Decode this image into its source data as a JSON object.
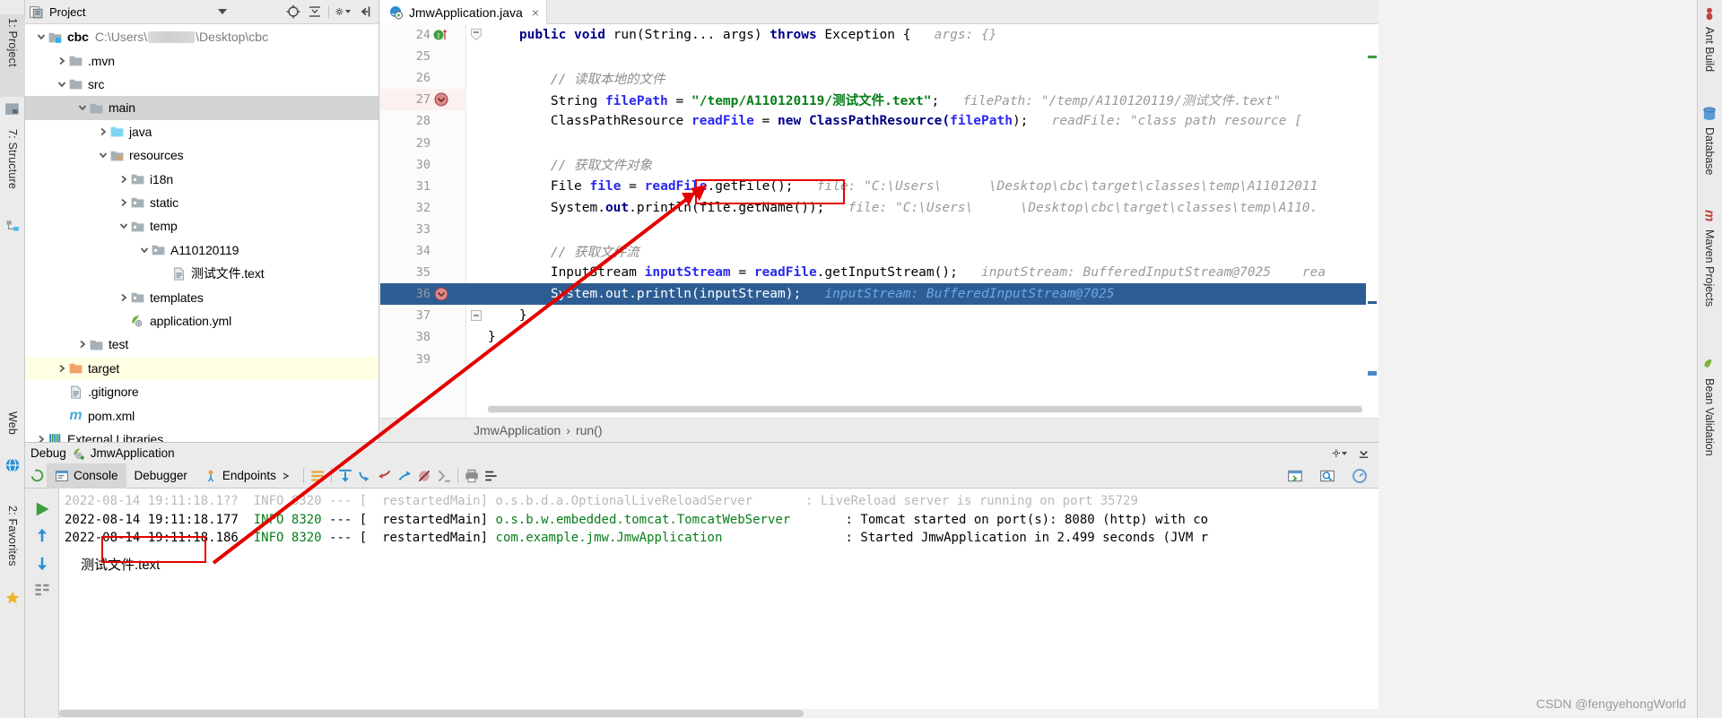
{
  "window": {
    "left_tool_tabs": [
      {
        "label": "1: Project",
        "icon": "project-icon",
        "active": true
      },
      {
        "label": "7: Structure",
        "icon": "structure-icon",
        "active": false
      },
      {
        "label": "Web",
        "icon": "web-icon",
        "active": false
      },
      {
        "label": "2: Favorites",
        "icon": "favorites-star-icon",
        "active": false
      }
    ],
    "right_tool_tabs": [
      {
        "label": "Ant Build",
        "icon": "ant-icon"
      },
      {
        "label": "Database",
        "icon": "database-icon"
      },
      {
        "label": "Maven Projects",
        "icon": "maven-m-icon"
      },
      {
        "label": "Bean Validation",
        "icon": "bean-icon"
      }
    ]
  },
  "project_panel": {
    "title": "Project",
    "header_icons": [
      "project-view-icon",
      "dropdown-caret-icon",
      "locate-target-icon",
      "collapse-expand-icon",
      "gear-icon",
      "hide-panel-icon"
    ],
    "tree": [
      {
        "label": "cbc",
        "path": "C:\\Users\\███\\Desktop\\cbc",
        "depth": 0,
        "arrow": "down",
        "icon": "module-folder-icon",
        "bold": true,
        "blurred_segment": true
      },
      {
        "label": ".mvn",
        "depth": 1,
        "arrow": "right",
        "icon": "folder-grey-icon"
      },
      {
        "label": "src",
        "depth": 1,
        "arrow": "down",
        "icon": "folder-grey-icon"
      },
      {
        "label": "main",
        "depth": 2,
        "arrow": "down",
        "icon": "folder-grey-icon",
        "selected": "grey"
      },
      {
        "label": "java",
        "depth": 3,
        "arrow": "right",
        "icon": "source-root-blue-icon"
      },
      {
        "label": "resources",
        "depth": 3,
        "arrow": "down",
        "icon": "resource-root-icon"
      },
      {
        "label": "i18n",
        "depth": 4,
        "arrow": "right",
        "icon": "folder-package-icon"
      },
      {
        "label": "static",
        "depth": 4,
        "arrow": "right",
        "icon": "folder-package-icon"
      },
      {
        "label": "temp",
        "depth": 4,
        "arrow": "down",
        "icon": "folder-package-icon"
      },
      {
        "label": "A110120119",
        "depth": 5,
        "arrow": "down",
        "icon": "folder-package-icon"
      },
      {
        "label": "测试文件.text",
        "depth": 6,
        "arrow": "none",
        "icon": "text-file-icon"
      },
      {
        "label": "templates",
        "depth": 4,
        "arrow": "right",
        "icon": "folder-package-icon"
      },
      {
        "label": "application.yml",
        "depth": 4,
        "arrow": "none",
        "icon": "spring-yml-icon"
      },
      {
        "label": "test",
        "depth": 2,
        "arrow": "right",
        "icon": "folder-grey-icon"
      },
      {
        "label": "target",
        "depth": 1,
        "arrow": "right",
        "icon": "folder-orange-icon",
        "selected": "yellow"
      },
      {
        "label": ".gitignore",
        "depth": 1,
        "arrow": "none",
        "icon": "text-file-icon"
      },
      {
        "label": "pom.xml",
        "depth": 1,
        "arrow": "none",
        "icon": "maven-m-icon"
      },
      {
        "label": "External Libraries",
        "depth": 0,
        "arrow": "right",
        "icon": "libraries-icon"
      }
    ]
  },
  "editor": {
    "tab": {
      "label": "JmwApplication.java",
      "icon": "spring-run-class-icon",
      "close": "×"
    },
    "breadcrumb": [
      "JmwApplication",
      "run()"
    ],
    "breadcrumb_separator": "›",
    "lines": [
      {
        "num": "24",
        "gutter_icon": "run-method-green-icon",
        "fold": "fold-collapse-icon",
        "tokens": [
          {
            "t": "    ",
            "c": ""
          },
          {
            "t": "public",
            "c": "kw"
          },
          {
            "t": " ",
            "c": ""
          },
          {
            "t": "void",
            "c": "kw"
          },
          {
            "t": " run(String... args) ",
            "c": ""
          },
          {
            "t": "throws",
            "c": "kw"
          },
          {
            "t": " Exception {",
            "c": ""
          },
          {
            "t": "   args: {}",
            "c": "hint"
          }
        ]
      },
      {
        "num": "25",
        "tokens": []
      },
      {
        "num": "26",
        "tokens": [
          {
            "t": "        ",
            "c": ""
          },
          {
            "t": "// 读取本地的文件",
            "c": "cmt"
          }
        ]
      },
      {
        "num": "27",
        "highlight": "pink",
        "gutter_icon": "breakpoint-disabled-icon",
        "tokens": [
          {
            "t": "        String ",
            "c": ""
          },
          {
            "t": "filePath",
            "c": "fld"
          },
          {
            "t": " = ",
            "c": ""
          },
          {
            "t": "\"/temp/A110120119/测试文件.text\"",
            "c": "str"
          },
          {
            "t": ";",
            "c": ""
          },
          {
            "t": "   filePath: \"/temp/A110120119/测试文件.text\"",
            "c": "hint"
          }
        ]
      },
      {
        "num": "28",
        "tokens": [
          {
            "t": "        ClassPathResource ",
            "c": ""
          },
          {
            "t": "readFile",
            "c": "fld"
          },
          {
            "t": " = ",
            "c": ""
          },
          {
            "t": "new",
            "c": "kw"
          },
          {
            "t": " ClassPathResource(",
            "c": "kw2"
          },
          {
            "t": "filePath",
            "c": "fld"
          },
          {
            "t": ");",
            "c": ""
          },
          {
            "t": "   readFile: \"class path resource [",
            "c": "hint"
          }
        ]
      },
      {
        "num": "29",
        "tokens": []
      },
      {
        "num": "30",
        "tokens": [
          {
            "t": "        ",
            "c": ""
          },
          {
            "t": "// 获取文件对象",
            "c": "cmt"
          }
        ]
      },
      {
        "num": "31",
        "tokens": [
          {
            "t": "        File ",
            "c": ""
          },
          {
            "t": "file",
            "c": "fld"
          },
          {
            "t": " = ",
            "c": ""
          },
          {
            "t": "readFile",
            "c": "fld"
          },
          {
            "t": ".getFile();",
            "c": ""
          },
          {
            "t": "   file: \"C:\\Users\\███\\Desktop\\cbc\\target\\classes\\temp\\A11012011",
            "c": "hint"
          }
        ]
      },
      {
        "num": "32",
        "tokens": [
          {
            "t": "        System.",
            "c": ""
          },
          {
            "t": "out",
            "c": "kw2"
          },
          {
            "t": ".println(file.getName());",
            "c": ""
          },
          {
            "t": "   file: \"C:\\Users\\███\\Desktop\\cbc\\target\\classes\\temp\\A110.",
            "c": "hint"
          }
        ]
      },
      {
        "num": "33",
        "tokens": []
      },
      {
        "num": "34",
        "tokens": [
          {
            "t": "        ",
            "c": ""
          },
          {
            "t": "// 获取文件流",
            "c": "cmt"
          }
        ]
      },
      {
        "num": "35",
        "tokens": [
          {
            "t": "        InputStream ",
            "c": ""
          },
          {
            "t": "inputStream",
            "c": "fld"
          },
          {
            "t": " = ",
            "c": ""
          },
          {
            "t": "readFile",
            "c": "fld"
          },
          {
            "t": ".getInputStream();",
            "c": ""
          },
          {
            "t": "   inputStream: BufferedInputStream@7025    rea",
            "c": "hint"
          }
        ]
      },
      {
        "num": "36",
        "highlight": "blue",
        "gutter_icon": "breakpoint-disabled-icon",
        "tokens": [
          {
            "t": "        System.",
            "c": "wht"
          },
          {
            "t": "out",
            "c": "wht"
          },
          {
            "t": ".println(",
            "c": "wht"
          },
          {
            "t": "inputStream",
            "c": "wht"
          },
          {
            "t": ");",
            "c": "wht"
          },
          {
            "t": "   inputStream: BufferedInputStream@7025",
            "c": "hint-blue"
          }
        ]
      },
      {
        "num": "37",
        "fold": "fold-collapse-icon",
        "tokens": [
          {
            "t": "    }",
            "c": ""
          }
        ]
      },
      {
        "num": "38",
        "tokens": [
          {
            "t": "}",
            "c": ""
          }
        ]
      },
      {
        "num": "39",
        "tokens": []
      }
    ]
  },
  "debug": {
    "header_label": "Debug",
    "header_config": "JmwApplication",
    "header_icon": "spring-boot-icon",
    "header_right_icons": [
      "gear-icon",
      "hide-icon"
    ],
    "tabs": [
      {
        "label": "Console",
        "icon": "console-icon",
        "active": true
      },
      {
        "label": "Debugger",
        "icon": "",
        "active": false
      },
      {
        "label": "Endpoints",
        "icon": "endpoints-icon",
        "active": false
      }
    ],
    "toolbar_icons": [
      "layout-icon",
      "scroll-to-end-icon",
      "step-over-icon",
      "step-into-icon",
      "step-out-icon",
      "mute-breakpoints-icon",
      "evaluate-icon",
      "print-icon",
      "settings-list-icon"
    ],
    "right_toolbar_icons": [
      "open-in-browser-icon",
      "search-icon",
      "profiler-icon"
    ],
    "rail_icons": [
      "resume-program-icon",
      "step-up-icon",
      "step-down-icon",
      "threads-icon"
    ],
    "console_lines": [
      {
        "faded": true,
        "text": "2022-08-14 19:11:18.1??  INFO 8320 --- [  restartedMain] o.s.b.d.a.OptionalLiveReloadServer       : LiveReload server is running on port 35729"
      },
      {
        "date": "2022-08-14 19:11:18.177",
        "level": "INFO",
        "pid": "8320",
        "sep": "---",
        "thread": "[  restartedMain]",
        "logger": "o.s.b.w.embedded.tomcat.TomcatWebServer",
        "colon": ":",
        "message": "Tomcat started on port(s): 8080 (http) with co"
      },
      {
        "date": "2022-08-14 19:11:18.186",
        "level": "INFO",
        "pid": "8320",
        "sep": "---",
        "thread": "[  restartedMain]",
        "logger": "com.example.jmw.JmwApplication",
        "colon": ":",
        "message": "Started JmwApplication in 2.499 seconds (JVM r"
      },
      {
        "output": "测试文件.text"
      }
    ]
  },
  "annotations": {
    "box_code_label": "file.getName()",
    "box_console_label": "测试文件.text",
    "arrow_color": "#e50000"
  },
  "watermark": "CSDN @fengyehongWorld"
}
